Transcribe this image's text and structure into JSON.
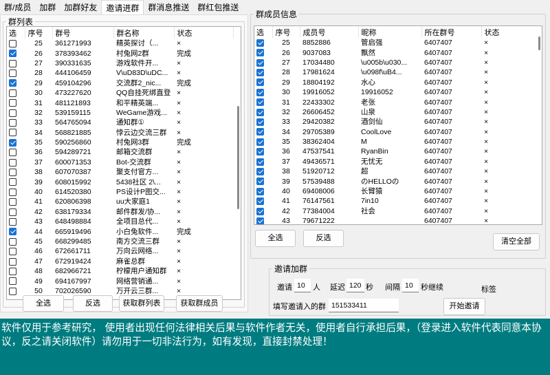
{
  "tabs": [
    {
      "label": "群/成员",
      "active": false
    },
    {
      "label": "加群",
      "active": false
    },
    {
      "label": "加群好友",
      "active": false
    },
    {
      "label": "邀请进群",
      "active": true
    },
    {
      "label": "群消息推送",
      "active": false
    },
    {
      "label": "群红包推送",
      "active": false
    }
  ],
  "group_list": {
    "title": "群列表",
    "columns": [
      "选",
      "序号",
      "群号",
      "群名称",
      "状态"
    ],
    "rows": [
      {
        "checked": false,
        "idx": "25",
        "qq": "361271993",
        "name": "精英探讨（...",
        "status": "×"
      },
      {
        "checked": true,
        "idx": "26",
        "qq": "378393462",
        "name": "村兔网2群",
        "status": "完成"
      },
      {
        "checked": false,
        "idx": "27",
        "qq": "390331635",
        "name": "游戏软件开...",
        "status": "×"
      },
      {
        "checked": false,
        "idx": "28",
        "qq": "444106459",
        "name": "V\\uD83D\\uDC...",
        "status": "×"
      },
      {
        "checked": true,
        "idx": "29",
        "qq": "459104296",
        "name": "交流群2_nic...",
        "status": "完成"
      },
      {
        "checked": false,
        "idx": "30",
        "qq": "473227620",
        "name": "QQ自挂死绑直登",
        "status": "×"
      },
      {
        "checked": false,
        "idx": "31",
        "qq": "481121893",
        "name": "和平精英端...",
        "status": "×"
      },
      {
        "checked": false,
        "idx": "32",
        "qq": "539159115",
        "name": "WeGame游戏...",
        "status": "×"
      },
      {
        "checked": false,
        "idx": "33",
        "qq": "564765094",
        "name": "通知群①",
        "status": "×"
      },
      {
        "checked": false,
        "idx": "34",
        "qq": "568821885",
        "name": "悖云边交流三群",
        "status": "×"
      },
      {
        "checked": true,
        "idx": "35",
        "qq": "590256860",
        "name": "村兔网3群",
        "status": "完成"
      },
      {
        "checked": false,
        "idx": "36",
        "qq": "594289721",
        "name": "邮箱交流群",
        "status": "×"
      },
      {
        "checked": false,
        "idx": "37",
        "qq": "600071353",
        "name": "Bot-交流群",
        "status": "×"
      },
      {
        "checked": false,
        "idx": "38",
        "qq": "607070387",
        "name": "聚支付官方...",
        "status": "×"
      },
      {
        "checked": false,
        "idx": "39",
        "qq": "608015992",
        "name": "5438社区 2\\...",
        "status": "×"
      },
      {
        "checked": false,
        "idx": "40",
        "qq": "614520380",
        "name": "PS设计P图交...",
        "status": "×"
      },
      {
        "checked": false,
        "idx": "41",
        "qq": "620806398",
        "name": "uu大家庭1",
        "status": "×"
      },
      {
        "checked": false,
        "idx": "42",
        "qq": "638179334",
        "name": "邮件群发/协...",
        "status": "×"
      },
      {
        "checked": false,
        "idx": "43",
        "qq": "648498884",
        "name": "全项目总代...",
        "status": "×"
      },
      {
        "checked": true,
        "idx": "44",
        "qq": "665919496",
        "name": "小白兔软件...",
        "status": "完成"
      },
      {
        "checked": false,
        "idx": "45",
        "qq": "668299485",
        "name": "南方交流三群",
        "status": "×"
      },
      {
        "checked": false,
        "idx": "46",
        "qq": "672661711",
        "name": "万向云网络...",
        "status": "×"
      },
      {
        "checked": false,
        "idx": "47",
        "qq": "672919424",
        "name": "麻雀总群",
        "status": "×"
      },
      {
        "checked": false,
        "idx": "48",
        "qq": "682966721",
        "name": "柠檬用户通知群",
        "status": "×"
      },
      {
        "checked": false,
        "idx": "49",
        "qq": "694167997",
        "name": "网络营销通...",
        "status": "×"
      },
      {
        "checked": false,
        "idx": "50",
        "qq": "702026590",
        "name": "万开云三群...",
        "status": "×"
      }
    ],
    "buttons": {
      "select_all": "全选",
      "invert": "反选",
      "get_groups": "获取群列表",
      "get_members": "获取群成员"
    }
  },
  "member_list": {
    "title": "群成员信息",
    "columns": [
      "选",
      "序号",
      "成员号",
      "昵称",
      "所在群号",
      "状态"
    ],
    "rows": [
      {
        "checked": true,
        "idx": "25",
        "qq": "8852886",
        "nick": "管启强",
        "group": "6407407",
        "status": "×"
      },
      {
        "checked": true,
        "idx": "26",
        "qq": "9037083",
        "nick": "飘然",
        "group": "6407407",
        "status": "×"
      },
      {
        "checked": true,
        "idx": "27",
        "qq": "17034480",
        "nick": "\\u005b\\u030...",
        "group": "6407407",
        "status": "×"
      },
      {
        "checked": true,
        "idx": "28",
        "qq": "17981624",
        "nick": "\\u098f\\uB4...",
        "group": "6407407",
        "status": "×"
      },
      {
        "checked": true,
        "idx": "29",
        "qq": "18804192",
        "nick": "水心",
        "group": "6407407",
        "status": "×"
      },
      {
        "checked": true,
        "idx": "30",
        "qq": "19916052",
        "nick": "19916052",
        "group": "6407407",
        "status": "×"
      },
      {
        "checked": true,
        "idx": "31",
        "qq": "22433302",
        "nick": "老张",
        "group": "6407407",
        "status": "×"
      },
      {
        "checked": true,
        "idx": "32",
        "qq": "26606452",
        "nick": "山泉",
        "group": "6407407",
        "status": "×"
      },
      {
        "checked": true,
        "idx": "33",
        "qq": "29420382",
        "nick": "酒剑仙",
        "group": "6407407",
        "status": "×"
      },
      {
        "checked": true,
        "idx": "34",
        "qq": "29705389",
        "nick": "CoolLove",
        "group": "6407407",
        "status": "×"
      },
      {
        "checked": true,
        "idx": "35",
        "qq": "38362404",
        "nick": "M",
        "group": "6407407",
        "status": "×"
      },
      {
        "checked": true,
        "idx": "36",
        "qq": "47537541",
        "nick": "RyanBin",
        "group": "6407407",
        "status": "×"
      },
      {
        "checked": true,
        "idx": "37",
        "qq": "49436571",
        "nick": "无忧无",
        "group": "6407407",
        "status": "×"
      },
      {
        "checked": true,
        "idx": "38",
        "qq": "51920712",
        "nick": " 超",
        "group": "6407407",
        "status": "×"
      },
      {
        "checked": true,
        "idx": "39",
        "qq": "57539488",
        "nick": "のHELLOの",
        "group": "6407407",
        "status": "×"
      },
      {
        "checked": true,
        "idx": "40",
        "qq": "69408006",
        "nick": "长臂猿",
        "group": "6407407",
        "status": "×"
      },
      {
        "checked": true,
        "idx": "41",
        "qq": "76147561",
        "nick": "7in10",
        "group": "6407407",
        "status": "×"
      },
      {
        "checked": true,
        "idx": "42",
        "qq": "77384004",
        "nick": "社会",
        "group": "6407407",
        "status": "×"
      },
      {
        "checked": true,
        "idx": "43",
        "qq": "79671222",
        "nick": "",
        "group": "6407407",
        "status": "×"
      }
    ],
    "buttons": {
      "select_all": "全选",
      "invert": "反选",
      "clear_all": "清空全部"
    }
  },
  "invite": {
    "title": "邀请加群",
    "invite_label": "邀请",
    "count_value": "10",
    "count_unit": "人",
    "delay_label": "延迟",
    "delay_value": "120",
    "delay_unit": "秒",
    "interval_label": "间隔",
    "interval_value": "10",
    "interval_unit": "秒继续",
    "tag_label": "标签",
    "target_label": "填写邀请入的群",
    "target_value": "151533411",
    "start_button": "开始邀请"
  },
  "footer_text": "软件仅用于参考研究，  使用者出现任何法律相关后果与软件作者无关，使用者自行承担后果，（登录进入软件代表同意本协议，反之请关闭软件）请勿用于一切非法行为，如有发现，直接封禁处理！",
  "colors": {
    "accent_checkbox": "#1a73d2",
    "footer_bg": "#007c80"
  }
}
